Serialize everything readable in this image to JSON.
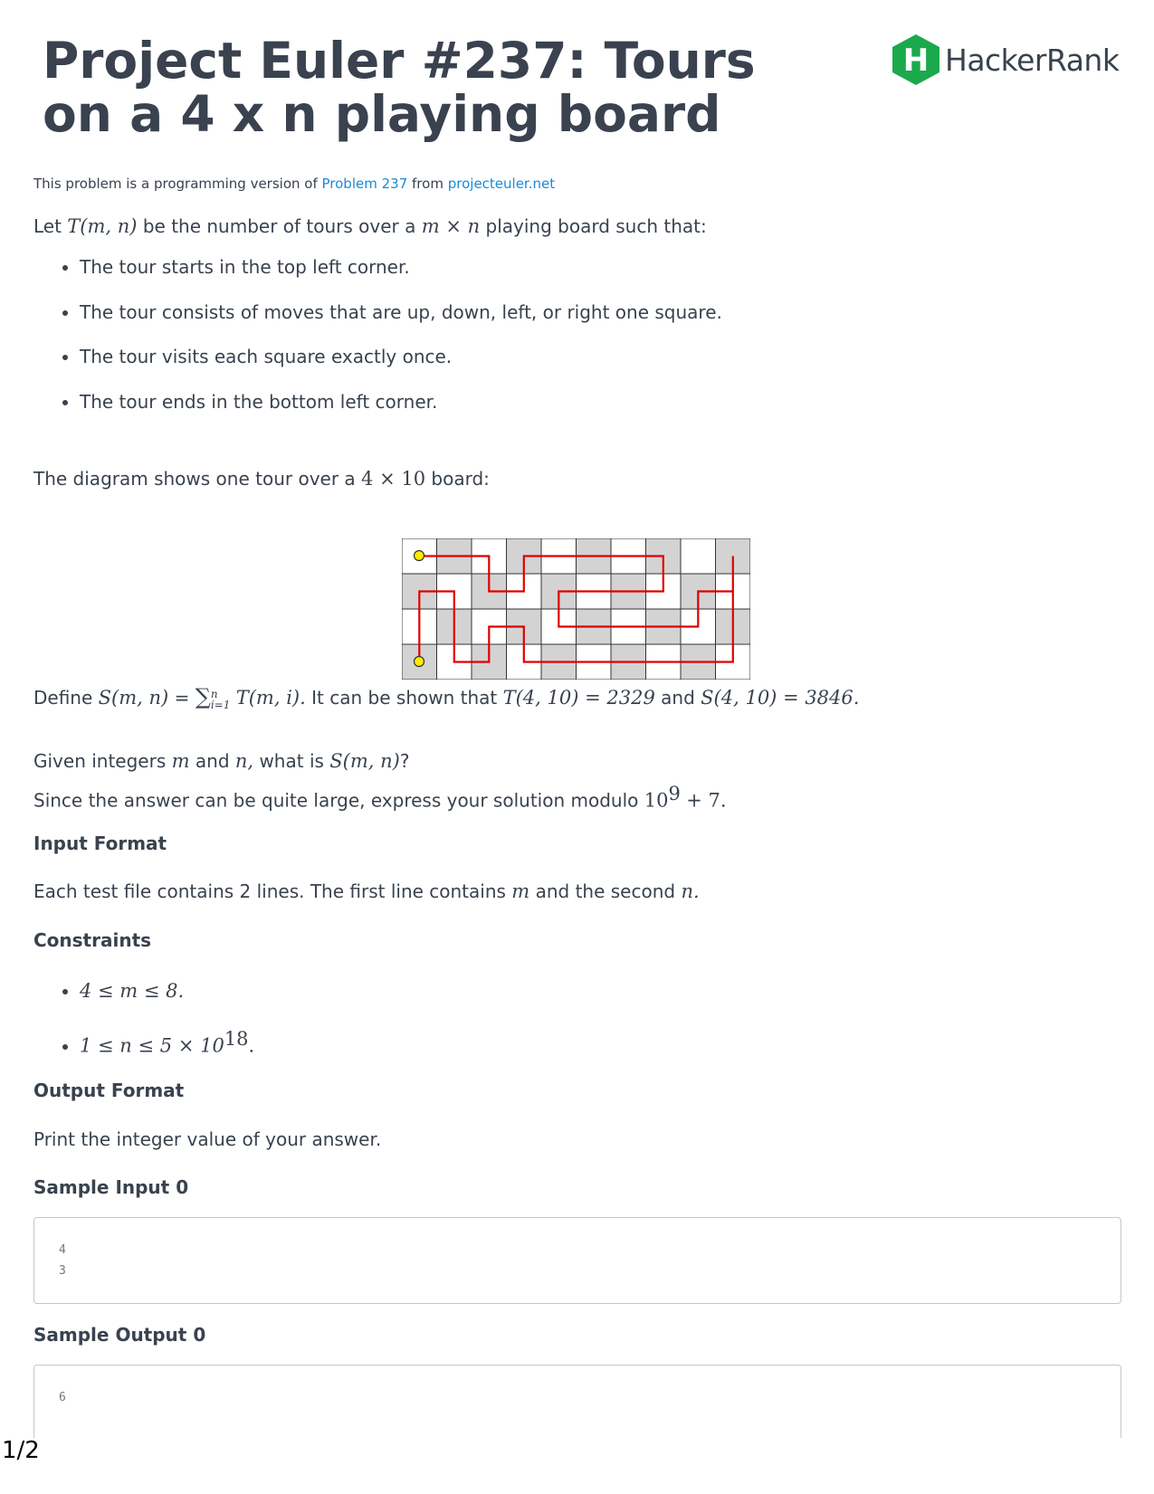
{
  "title": "Project Euler #237: Tours on a 4 x n playing board",
  "logo": {
    "text": "HackerRank",
    "icon_letter": "H",
    "color": "#1ba94c"
  },
  "intro": {
    "prefix": "This problem is a programming version of",
    "link1": "Problem 237",
    "middle": "from",
    "link2": "projecteuler.net"
  },
  "definition": {
    "let": "Let",
    "T": "T(m, n)",
    "text": "be the number of tours over a",
    "board": "m × n",
    "suffix": "playing board such that:"
  },
  "rules": [
    "The tour starts in the top left corner.",
    "The tour consists of moves that are up, down, left, or right one square.",
    "The tour visits each square exactly once.",
    "The tour ends in the bottom left corner."
  ],
  "diagram_caption": {
    "prefix": "The diagram shows one tour over a",
    "size": "4 × 10",
    "suffix": "board:"
  },
  "define_S": {
    "prefix": "Define",
    "S": "S(m, n)",
    "eq": "=",
    "sum": "∑",
    "sum_top": "n",
    "sum_bottom": "i=1",
    "term": "T(m, i).",
    "text": "It can be shown that",
    "t_value": "T(4, 10) = 2329",
    "and": "and",
    "s_value": "S(4, 10) = 3846."
  },
  "question": {
    "p1": "Given integers",
    "m": "m",
    "and": "and",
    "n": "n,",
    "p2": "what is",
    "S": "S(m, n)",
    "q": "?"
  },
  "modulo": {
    "text": "Since the answer can be quite large, express your solution modulo",
    "base": "10",
    "exp": "9",
    "tail": "+ 7."
  },
  "input_format": {
    "heading": "Input Format",
    "text1": "Each test file contains 2 lines. The first line contains",
    "m": "m",
    "text2": "and the second",
    "n": "n."
  },
  "constraints": {
    "heading": "Constraints",
    "c1": "4 ≤ m ≤ 8.",
    "c2_base": "1 ≤ n ≤ 5 × 10",
    "c2_exp": "18",
    "c2_tail": "."
  },
  "output_format": {
    "heading": "Output Format",
    "text": "Print the integer value of your answer."
  },
  "sample_input": {
    "heading": "Sample Input 0",
    "lines": [
      "4",
      "3"
    ]
  },
  "sample_output": {
    "heading": "Sample Output 0",
    "lines": [
      "6"
    ]
  },
  "page_number": "1/2",
  "colors": {
    "text": "#39424e",
    "link": "#1a8bd6",
    "path": "#e00000",
    "grey_cell": "#d3d3d3",
    "dot": "#ffeb00"
  }
}
